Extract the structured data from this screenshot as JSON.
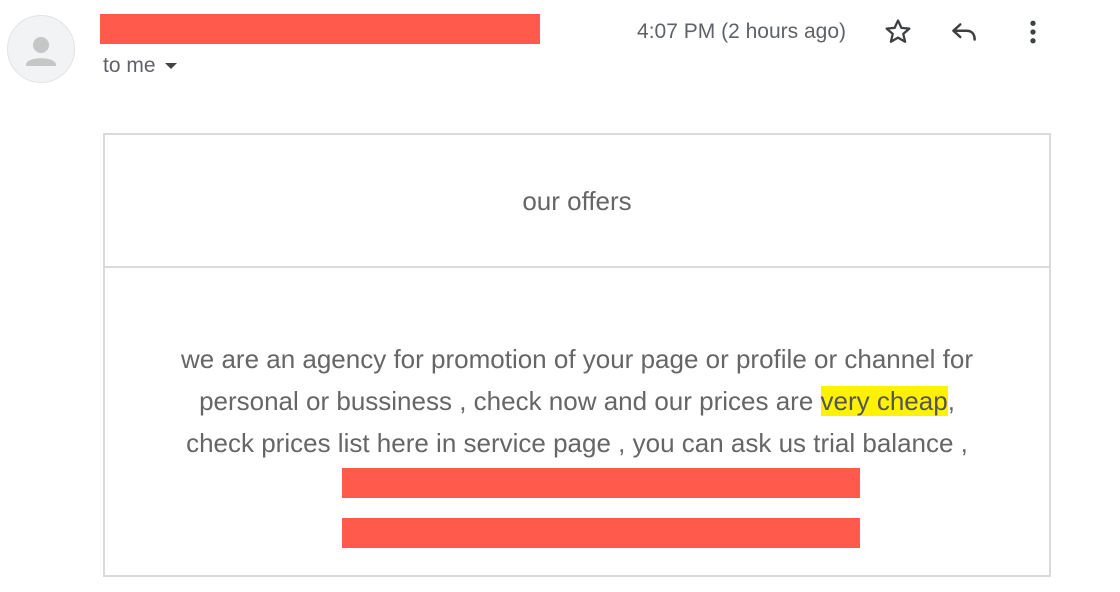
{
  "header": {
    "timestamp": "4:07 PM (2 hours ago)",
    "recipient_label": "to me",
    "icons": {
      "avatar": "person-icon",
      "star": "star-icon",
      "reply": "reply-icon",
      "more": "more-vert-icon",
      "dropdown": "caret-down-icon"
    }
  },
  "email": {
    "subject_heading": "our offers",
    "body_line_1": "we are an agency for promotion of your page or profile or channel for",
    "body_line_2_start": "personal or bussiness , check now and our prices are ",
    "body_line_2_highlight": "very cheap",
    "body_line_2_end": ",",
    "body_line_3": "check prices list here in service page , you can ask us trial balance ,"
  },
  "colors": {
    "redaction": "#ff5a4c",
    "highlight": "#fff200",
    "text": "#666666",
    "border": "#dadada"
  }
}
